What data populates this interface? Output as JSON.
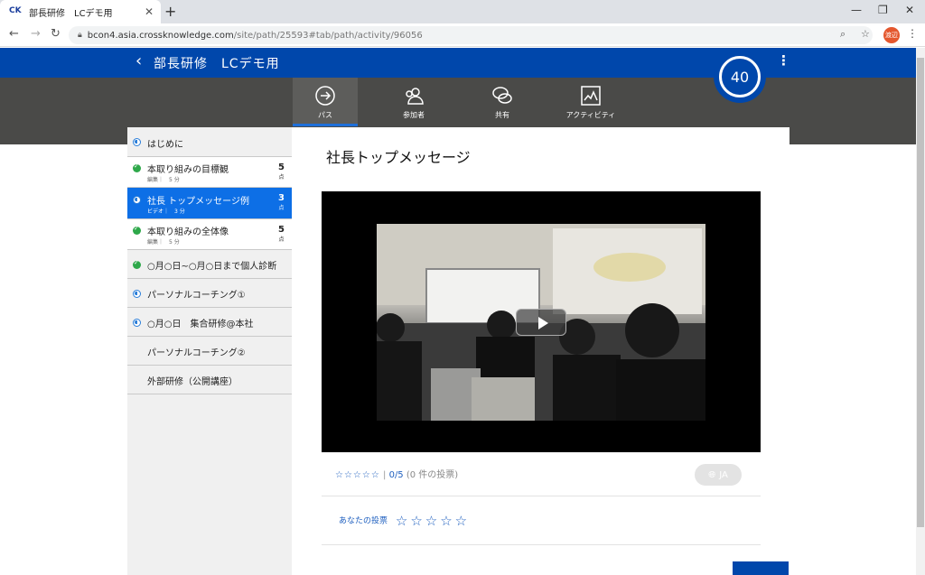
{
  "browser": {
    "tab_title": "部長研修　LCデモ用",
    "favicon_text": "CK",
    "url_host": "bcon4.asia.crossknowledge.com",
    "url_path": "/site/path/25593#tab/path/activity/96056",
    "profile_initials": "渡辺"
  },
  "header": {
    "title": "部長研修　LCデモ用",
    "score": "40"
  },
  "tabs": [
    {
      "label": "パス",
      "icon": "path-arrow-icon",
      "active": true
    },
    {
      "label": "参加者",
      "icon": "participants-icon",
      "active": false
    },
    {
      "label": "共有",
      "icon": "chat-bubbles-icon",
      "active": false
    },
    {
      "label": "アクティビティ",
      "icon": "activity-chart-icon",
      "active": false
    }
  ],
  "sidebar": {
    "items": [
      {
        "label": "はじめに",
        "sub": "",
        "points": "",
        "unit": "",
        "status": "in-progress"
      },
      {
        "label": "本取り組みの目標観",
        "sub": "編集｜　5 分",
        "points": "5",
        "unit": "点",
        "status": "done"
      },
      {
        "label": "社長 トップメッセージ例",
        "sub": "ビデオ｜　3 分",
        "points": "3",
        "unit": "点",
        "status": "in-progress"
      },
      {
        "label": "本取り組みの全体像",
        "sub": "編集｜　5 分",
        "points": "5",
        "unit": "点",
        "status": "done"
      },
      {
        "label": "○月○日~○月○日まで個人診断",
        "sub": "",
        "points": "",
        "unit": "",
        "status": "done"
      },
      {
        "label": "パーソナルコーチング①",
        "sub": "",
        "points": "",
        "unit": "",
        "status": "in-progress"
      },
      {
        "label": "○月○日　集合研修@本社",
        "sub": "",
        "points": "",
        "unit": "",
        "status": "in-progress"
      },
      {
        "label": "パーソナルコーチング②",
        "sub": "",
        "points": "",
        "unit": "",
        "status": "none"
      },
      {
        "label": "外部研修（公開講座）",
        "sub": "",
        "points": "",
        "unit": "",
        "status": "none"
      }
    ]
  },
  "content": {
    "title": "社長トップメッセージ",
    "rating_stars": "☆☆☆☆☆",
    "rating_score": "0/5",
    "rating_votes": "(0 件の投票)",
    "language": "JA",
    "your_vote_label": "あなたの投票",
    "your_vote_stars": "☆☆☆☆☆"
  }
}
